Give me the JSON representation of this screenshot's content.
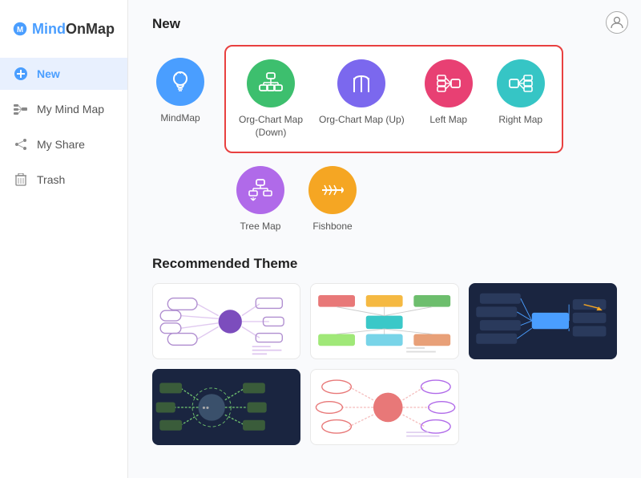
{
  "logo": {
    "brand": "MindOnMap"
  },
  "sidebar": {
    "items": [
      {
        "id": "new",
        "label": "New",
        "icon": "+",
        "active": true
      },
      {
        "id": "my-mind-map",
        "label": "My Mind Map",
        "icon": "map"
      },
      {
        "id": "my-share",
        "label": "My Share",
        "icon": "share"
      },
      {
        "id": "trash",
        "label": "Trash",
        "icon": "trash"
      }
    ]
  },
  "main": {
    "new_section_title": "New",
    "templates": [
      {
        "id": "mindmap",
        "label": "MindMap",
        "color": "#4a9eff",
        "icon_type": "bulb"
      },
      {
        "id": "org-chart-down",
        "label": "Org-Chart Map\n(Down)",
        "color": "#3dbf6e",
        "icon_type": "org-down"
      },
      {
        "id": "org-chart-up",
        "label": "Org-Chart Map (Up)",
        "color": "#7b68ee",
        "icon_type": "org-up"
      },
      {
        "id": "left-map",
        "label": "Left Map",
        "color": "#e84073",
        "icon_type": "left"
      },
      {
        "id": "right-map",
        "label": "Right Map",
        "color": "#36c5c5",
        "icon_type": "right"
      }
    ],
    "templates_row2": [
      {
        "id": "tree-map",
        "label": "Tree Map",
        "color": "#b06ae9",
        "icon_type": "tree"
      },
      {
        "id": "fishbone",
        "label": "Fishbone",
        "color": "#f5a623",
        "icon_type": "fishbone"
      }
    ],
    "recommended_title": "Recommended Theme",
    "themes": [
      {
        "id": "theme1",
        "dark": false,
        "accent": "#7c4dbd"
      },
      {
        "id": "theme2",
        "dark": false,
        "accent": "#3bc8c8"
      },
      {
        "id": "theme3",
        "dark": true,
        "accent": "#4a9eff"
      },
      {
        "id": "theme4",
        "dark": true,
        "accent": "#6dbe6d"
      },
      {
        "id": "theme5",
        "dark": false,
        "accent": "#e87878"
      }
    ]
  }
}
